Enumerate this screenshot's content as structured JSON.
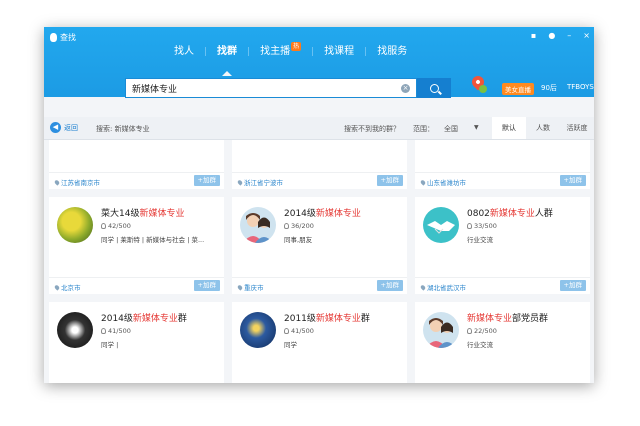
{
  "app": {
    "title": "查找"
  },
  "nav": {
    "tabs": [
      {
        "label": "找人"
      },
      {
        "label": "找群"
      },
      {
        "label": "找主播",
        "badge": "热"
      },
      {
        "label": "找课程"
      },
      {
        "label": "找服务"
      }
    ],
    "active": "找群"
  },
  "search": {
    "value": "新媒体专业",
    "clear_icon": "×"
  },
  "hot_tags": {
    "live": "美女直播",
    "t90": "90后",
    "tfboys": "TFBOYS"
  },
  "subbar": {
    "back_label": "返回",
    "search_label": "搜索: 新媒体专业",
    "not_found": "搜索不到我的群？",
    "range_label": "范围：",
    "range_value": "全国",
    "sort_tabs": [
      "默认",
      "人数",
      "活跃度"
    ],
    "sort_active": "默认"
  },
  "join_label": "+加群",
  "top_row_locations": [
    "江苏省南京市",
    "浙江省宁波市",
    "山东省潍坊市"
  ],
  "groups": [
    {
      "prefix": "菜大14级",
      "highlight": "新媒体专业",
      "suffix": "",
      "members": "42/500",
      "tags": "同学 | 莱斯特 | 新媒体与社会 | 菜...",
      "location": "北京市",
      "avatar": "flowers-avatar"
    },
    {
      "prefix": "2014级",
      "highlight": "新媒体专业",
      "suffix": "",
      "members": "36/200",
      "tags": "同事,朋友",
      "location": "重庆市",
      "avatar": "people-avatar"
    },
    {
      "prefix": "0802",
      "highlight": "新媒体专业",
      "suffix": "人群",
      "members": "33/500",
      "tags": "行业交流",
      "location": "湖北省武汉市",
      "avatar": "handshake-avatar"
    },
    {
      "prefix": "2014级",
      "highlight": "新媒体专业",
      "suffix": "群",
      "members": "41/500",
      "tags": "同学 |",
      "location": "",
      "avatar": "dark-avatar"
    },
    {
      "prefix": "2011级",
      "highlight": "新媒体专业",
      "suffix": "群",
      "members": "41/500",
      "tags": "同学",
      "location": "",
      "avatar": "painting-avatar"
    },
    {
      "prefix": "",
      "highlight": "新媒体专业",
      "suffix": "部党员群",
      "members": "22/500",
      "tags": "行业交流",
      "location": "",
      "avatar": "people-avatar"
    }
  ]
}
